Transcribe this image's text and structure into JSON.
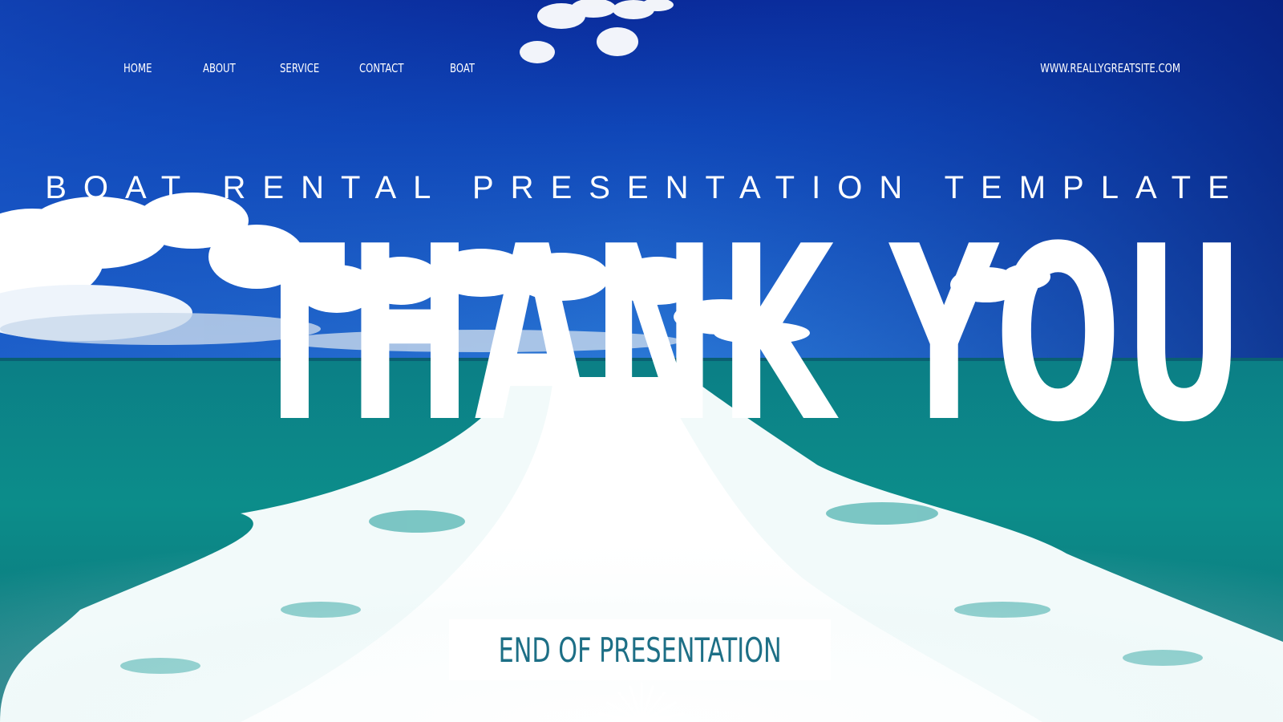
{
  "nav": {
    "items": [
      {
        "label": "HOME"
      },
      {
        "label": "ABOUT"
      },
      {
        "label": "SERVICE"
      },
      {
        "label": "CONTACT"
      },
      {
        "label": "BOAT"
      }
    ],
    "site_url": "WWW.REALLYGREATSITE.COM"
  },
  "hero": {
    "subtitle": "BOAT RENTAL PRESENTATION TEMPLATE",
    "headline": "THANK YOU"
  },
  "cta": {
    "label": "END OF PRESENTATION"
  },
  "colors": {
    "sky_top": "#0a2f9e",
    "sky_mid": "#1a5ccf",
    "sea": "#0f8a8a",
    "foam": "#ffffff",
    "button_text": "#1d6f86"
  },
  "icons": {
    "decor": "sunburst-icon"
  }
}
